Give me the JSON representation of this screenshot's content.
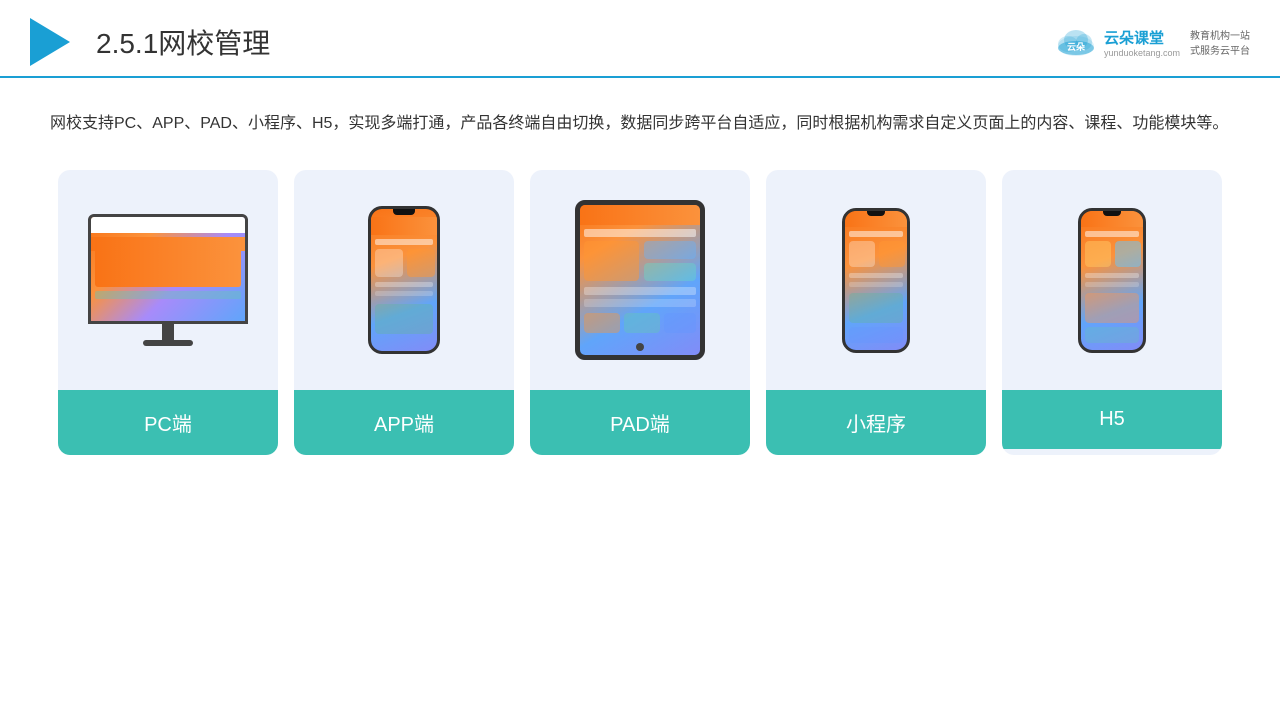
{
  "header": {
    "title_prefix": "2.5.1",
    "title_main": "网校管理",
    "logo": {
      "brand": "云朵课堂",
      "url": "yunduoketang.com",
      "tagline": "教育机构一站",
      "tagline2": "式服务云平台"
    }
  },
  "description": "网校支持PC、APP、PAD、小程序、H5，实现多端打通，产品各终端自由切换，数据同步跨平台自适应，同时根据机构需求自定义页面上的内容、课程、功能模块等。",
  "cards": [
    {
      "id": "pc",
      "label": "PC端",
      "device": "pc"
    },
    {
      "id": "app",
      "label": "APP端",
      "device": "phone"
    },
    {
      "id": "pad",
      "label": "PAD端",
      "device": "tablet"
    },
    {
      "id": "mini",
      "label": "小程序",
      "device": "phone-mini"
    },
    {
      "id": "h5",
      "label": "H5",
      "device": "phone-mini2"
    }
  ],
  "colors": {
    "accent": "#1a9fd4",
    "card_bg": "#eef2f8",
    "card_label_bg": "#3bbfb2",
    "title_color": "#333333"
  }
}
